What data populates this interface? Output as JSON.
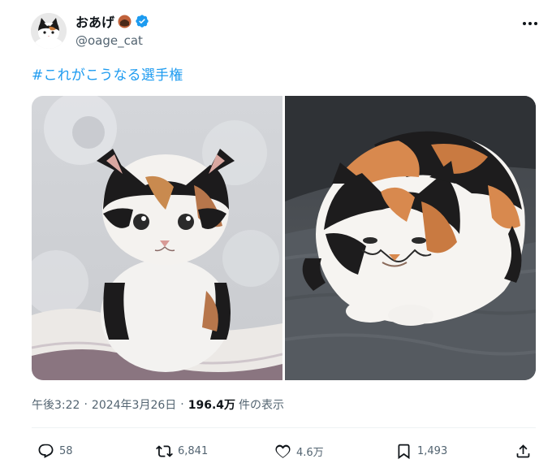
{
  "author": {
    "display_name": "おあげ",
    "handle": "@oage_cat",
    "verified": true,
    "avatar_icon": "cat-avatar",
    "name_emoji": "brown-circle-emoji"
  },
  "tweet": {
    "hashtag": "#これがこうなる選手権",
    "media": [
      {
        "icon": "kitten-photo"
      },
      {
        "icon": "adult-cat-photo"
      }
    ]
  },
  "meta": {
    "time": "午後3:22",
    "separator": "·",
    "date": "2024年3月26日",
    "views_count": "196.4万",
    "views_label": "件の表示"
  },
  "actions": {
    "replies": "58",
    "reposts": "6,841",
    "likes": "4.6万",
    "bookmarks": "1,493"
  },
  "colors": {
    "link": "#1d9bf0",
    "secondary_text": "#536471",
    "primary_text": "#0f1419",
    "divider": "#eff3f4"
  }
}
